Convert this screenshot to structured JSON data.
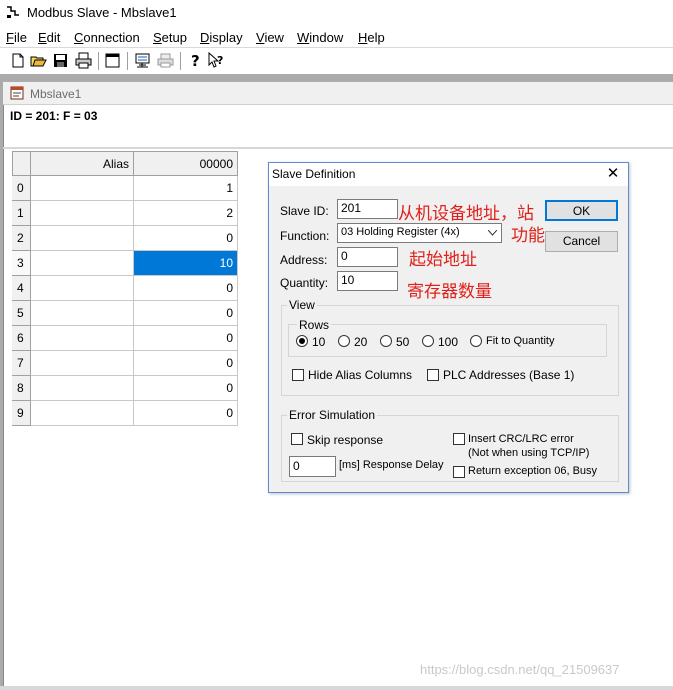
{
  "window": {
    "title": "Modbus Slave - Mbslave1"
  },
  "menu": [
    {
      "label": "File",
      "key": "F",
      "rest": "ile"
    },
    {
      "label": "Edit",
      "key": "E",
      "rest": "dit"
    },
    {
      "label": "Connection",
      "key": "C",
      "rest": "onnection"
    },
    {
      "label": "Setup",
      "key": "S",
      "rest": "etup"
    },
    {
      "label": "Display",
      "key": "D",
      "rest": "isplay"
    },
    {
      "label": "View",
      "key": "V",
      "rest": "iew"
    },
    {
      "label": "Window",
      "key": "W",
      "rest": "indow"
    },
    {
      "label": "Help",
      "key": "H",
      "rest": "elp"
    }
  ],
  "toolbar_icons": [
    "new-icon",
    "open-icon",
    "save-icon",
    "print-icon",
    "window-icon",
    "read-write-icon",
    "print-setup-icon",
    "help-icon",
    "context-help-icon"
  ],
  "child": {
    "title": "Mbslave1",
    "id_line": "ID = 201: F = 03"
  },
  "grid": {
    "col_alias": "Alias",
    "col_addr": "00000",
    "rows": [
      {
        "n": "0",
        "v": "1"
      },
      {
        "n": "1",
        "v": "2"
      },
      {
        "n": "2",
        "v": "0"
      },
      {
        "n": "3",
        "v": "10"
      },
      {
        "n": "4",
        "v": "0"
      },
      {
        "n": "5",
        "v": "0"
      },
      {
        "n": "6",
        "v": "0"
      },
      {
        "n": "7",
        "v": "0"
      },
      {
        "n": "8",
        "v": "0"
      },
      {
        "n": "9",
        "v": "0"
      }
    ],
    "selected_row": 3
  },
  "dialog": {
    "title": "Slave Definition",
    "close": "✕",
    "slave_id_label": "Slave ID:",
    "slave_id": "201",
    "function_label": "Function:",
    "function_value": "03 Holding Register (4x)",
    "address_label": "Address:",
    "address": "0",
    "quantity_label": "Quantity:",
    "quantity": "10",
    "ok": "OK",
    "cancel": "Cancel",
    "view_group": "View",
    "rows_group": "Rows",
    "rows_options": [
      "10",
      "20",
      "50",
      "100",
      "Fit to Quantity"
    ],
    "rows_selected": "10",
    "hide_alias": "Hide Alias Columns",
    "plc_addresses": "PLC Addresses (Base 1)",
    "error_group": "Error Simulation",
    "skip_response": "Skip response",
    "insert_crc": "Insert CRC/LRC error",
    "insert_crc_note": "(Not when using TCP/IP)",
    "delay_value": "0",
    "delay_label": "[ms] Response Delay",
    "return_exception": "Return exception 06, Busy"
  },
  "annotations": {
    "slave_addr": "从机设备地址，站",
    "function": "功能",
    "start_addr": "起始地址",
    "reg_count": "寄存器数量"
  },
  "watermark": "https://blog.csdn.net/qq_21509637",
  "colors": {
    "selection": "#0078d7",
    "annotation": "#e0201a",
    "dialog_border": "#5b8fd0"
  }
}
